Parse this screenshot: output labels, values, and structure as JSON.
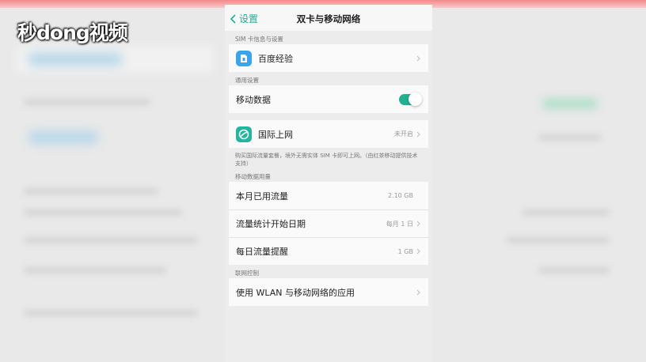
{
  "watermark": "秒dong视频",
  "nav": {
    "back_label": "设置",
    "title": "双卡与移动网络"
  },
  "sections": {
    "sim_info": "SIM 卡信息与设置",
    "general": "通用设置",
    "data_usage": "移动数据用量",
    "network_control": "联网控制"
  },
  "sim_card": {
    "label": "百度经验",
    "icon": "sim-card-icon"
  },
  "mobile_data": {
    "label": "移动数据",
    "enabled": true
  },
  "intl_net": {
    "label": "国际上网",
    "status": "未开启",
    "icon": "globe-plane-icon",
    "note": "购买国际流量套餐，境外无需实体 SIM 卡即可上网。（由红茶移动提供技术支持）"
  },
  "usage": [
    {
      "label": "本月已用流量",
      "value": "2.10 GB",
      "chevron": false
    },
    {
      "label": "流量统计开始日期",
      "value": "每月 1 日",
      "chevron": true
    },
    {
      "label": "每日流量提醒",
      "value": "1 GB",
      "chevron": true
    }
  ],
  "wlan_apps": {
    "label": "使用 WLAN 与移动网络的应用"
  },
  "colors": {
    "accent": "#1fae97",
    "toggle_on": "#23b08f",
    "sim_icon_bg": "#3ea4ea"
  }
}
